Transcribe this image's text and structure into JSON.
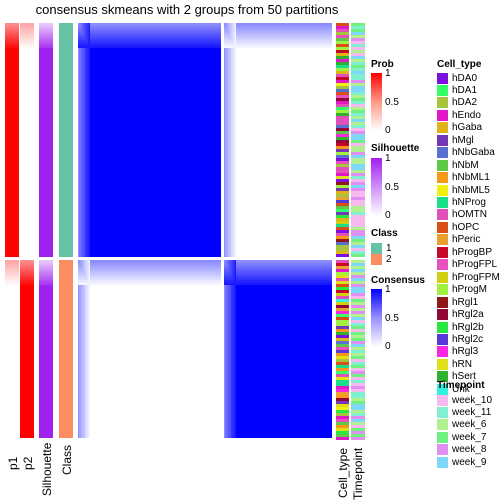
{
  "chart_data": {
    "type": "heatmap",
    "title": "consensus skmeans with 2 groups from 50 partitions",
    "n_groups": 2,
    "n_partitions": 50,
    "group_split_fraction": 0.57,
    "annotation_columns_left": [
      "p1",
      "p2",
      "Silhouette",
      "Class"
    ],
    "annotation_columns_right": [
      "Cell_type",
      "Timepoint"
    ],
    "groups": [
      {
        "class": "1",
        "p1": 1.0,
        "p2": 0.0,
        "silhouette": 0.95,
        "within_consensus": 1.0,
        "between_consensus": 0.0
      },
      {
        "class": "2",
        "p1": 0.0,
        "p2": 1.0,
        "silhouette": 0.95,
        "within_consensus": 1.0,
        "between_consensus": 0.0
      }
    ],
    "legends": {
      "prob": {
        "title": "Prob",
        "ticks": [
          "1",
          "0.5",
          "0"
        ],
        "color_low": "#ffffff",
        "color_high": "#ff0000"
      },
      "silhouette": {
        "title": "Silhouette",
        "ticks": [
          "1",
          "0.5",
          "0"
        ],
        "color_low": "#ffffff",
        "color_high": "#a020f0"
      },
      "class": {
        "title": "Class",
        "items": [
          {
            "label": "1",
            "color": "#66c2a5"
          },
          {
            "label": "2",
            "color": "#fc8d62"
          }
        ]
      },
      "consensus": {
        "title": "Consensus",
        "ticks": [
          "1",
          "0.5",
          "0"
        ],
        "color_low": "#ffffff",
        "color_high": "#0000ff"
      },
      "cell_type": {
        "title": "Cell_type",
        "items": [
          {
            "label": "hDA0",
            "color": "#7b10e0"
          },
          {
            "label": "hDA1",
            "color": "#33ff66"
          },
          {
            "label": "hDA2",
            "color": "#a8c43c"
          },
          {
            "label": "hEndo",
            "color": "#e018c8"
          },
          {
            "label": "hGaba",
            "color": "#e0b418"
          },
          {
            "label": "hMgl",
            "color": "#7438b8"
          },
          {
            "label": "hNbGaba",
            "color": "#5870d0"
          },
          {
            "label": "hNbM",
            "color": "#60c848"
          },
          {
            "label": "hNbML1",
            "color": "#f89818"
          },
          {
            "label": "hNbML5",
            "color": "#f0f010"
          },
          {
            "label": "hNProg",
            "color": "#18e088"
          },
          {
            "label": "hOMTN",
            "color": "#e050b8"
          },
          {
            "label": "hOPC",
            "color": "#d85018"
          },
          {
            "label": "hPeric",
            "color": "#e8a030"
          },
          {
            "label": "hProgBP",
            "color": "#c80828"
          },
          {
            "label": "hProgFPL",
            "color": "#e850c0"
          },
          {
            "label": "hProgFPM",
            "color": "#d0d010"
          },
          {
            "label": "hProgM",
            "color": "#a0f040"
          },
          {
            "label": "hRgl1",
            "color": "#901818"
          },
          {
            "label": "hRgl2a",
            "color": "#900838"
          },
          {
            "label": "hRgl2b",
            "color": "#28e840"
          },
          {
            "label": "hRgl2c",
            "color": "#5838d8"
          },
          {
            "label": "hRgl3",
            "color": "#f828e0"
          },
          {
            "label": "hRN",
            "color": "#e0e018"
          },
          {
            "label": "hSert",
            "color": "#30b030"
          },
          {
            "label": "Unk",
            "color": "#30f0e0"
          }
        ]
      },
      "timepoint": {
        "title": "Timepoint",
        "items": [
          {
            "label": "week_10",
            "color": "#f8b8f0"
          },
          {
            "label": "week_11",
            "color": "#80f0d0"
          },
          {
            "label": "week_6",
            "color": "#b0f090"
          },
          {
            "label": "week_7",
            "color": "#70f080"
          },
          {
            "label": "week_8",
            "color": "#e090f0"
          },
          {
            "label": "week_9",
            "color": "#80d8f8"
          }
        ]
      }
    }
  }
}
